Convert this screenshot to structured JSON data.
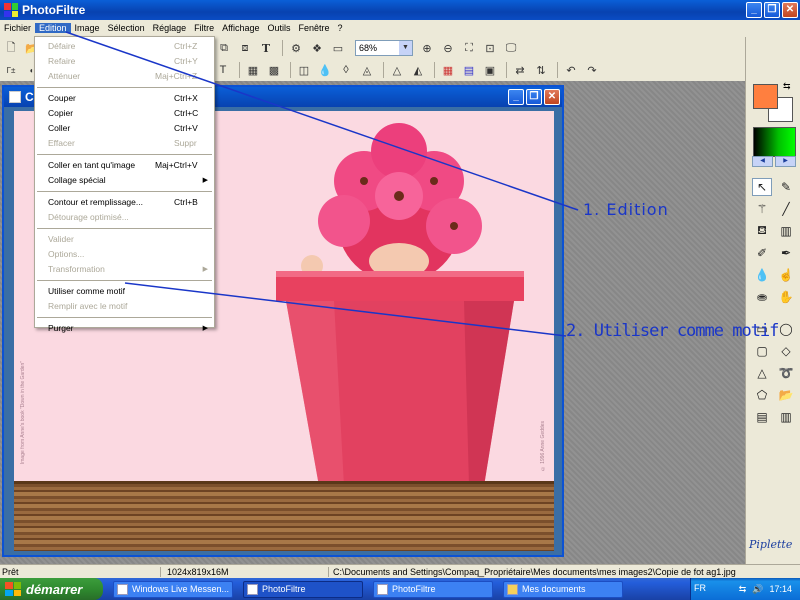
{
  "window": {
    "title": "PhotoFiltre"
  },
  "menu": [
    "Fichier",
    "Edition",
    "Image",
    "Sélection",
    "Réglage",
    "Filtre",
    "Affichage",
    "Outils",
    "Fenêtre",
    "?"
  ],
  "active_menu": "Edition",
  "toolbar": {
    "zoom": "68%"
  },
  "document": {
    "title": "Co"
  },
  "edit_menu": {
    "items": [
      {
        "label": "Défaire",
        "shortcut": "Ctrl+Z",
        "disabled": true
      },
      {
        "label": "Refaire",
        "shortcut": "Ctrl+Y",
        "disabled": true
      },
      {
        "label": "Atténuer",
        "shortcut": "Maj+Ctrl+Z",
        "disabled": true
      },
      {
        "sep": true
      },
      {
        "label": "Couper",
        "shortcut": "Ctrl+X",
        "disabled": false
      },
      {
        "label": "Copier",
        "shortcut": "Ctrl+C",
        "disabled": false
      },
      {
        "label": "Coller",
        "shortcut": "Ctrl+V",
        "disabled": false
      },
      {
        "label": "Effacer",
        "shortcut": "Suppr",
        "disabled": true
      },
      {
        "sep": true
      },
      {
        "label": "Coller en tant qu'image",
        "shortcut": "Maj+Ctrl+V",
        "disabled": false
      },
      {
        "label": "Collage spécial",
        "submenu": true,
        "disabled": false
      },
      {
        "sep": true
      },
      {
        "label": "Contour et remplissage...",
        "shortcut": "Ctrl+B",
        "disabled": false
      },
      {
        "label": "Détourage optimisé...",
        "disabled": true
      },
      {
        "sep": true
      },
      {
        "label": "Valider",
        "disabled": true
      },
      {
        "label": "Options...",
        "disabled": true
      },
      {
        "label": "Transformation",
        "submenu": true,
        "disabled": true
      },
      {
        "sep": true
      },
      {
        "label": "Utiliser comme motif",
        "disabled": false
      },
      {
        "label": "Remplir avec le motif",
        "disabled": true
      },
      {
        "sep": true
      },
      {
        "label": "Purger",
        "submenu": true,
        "disabled": false
      }
    ]
  },
  "canvas": {
    "side_text_left": "Image from Anne's book \"Down in the Garden\"",
    "side_text_right": "© 1996 Anne Geddes",
    "colors": {
      "bg": "#fbd9e1",
      "pot": "#e8415f",
      "flowers": "#e83a73"
    }
  },
  "annotations": {
    "step1": "1. Edition",
    "step2": "2. Utiliser comme motif",
    "color": "#1a36c8"
  },
  "signature": "Piplette",
  "status": {
    "state": "Prêt",
    "size": "1024x819x16M",
    "path": "C:\\Documents and Settings\\Compaq_Propriétaire\\Mes documents\\mes images2\\Copie de fot ag1.jpg"
  },
  "taskbar": {
    "start": "démarrer",
    "tasks": [
      "Windows Live Messen...",
      "PhotoFiltre",
      "PhotoFiltre",
      "Mes documents"
    ],
    "active_task_index": 1,
    "lang": "FR",
    "clock": "17:14"
  }
}
